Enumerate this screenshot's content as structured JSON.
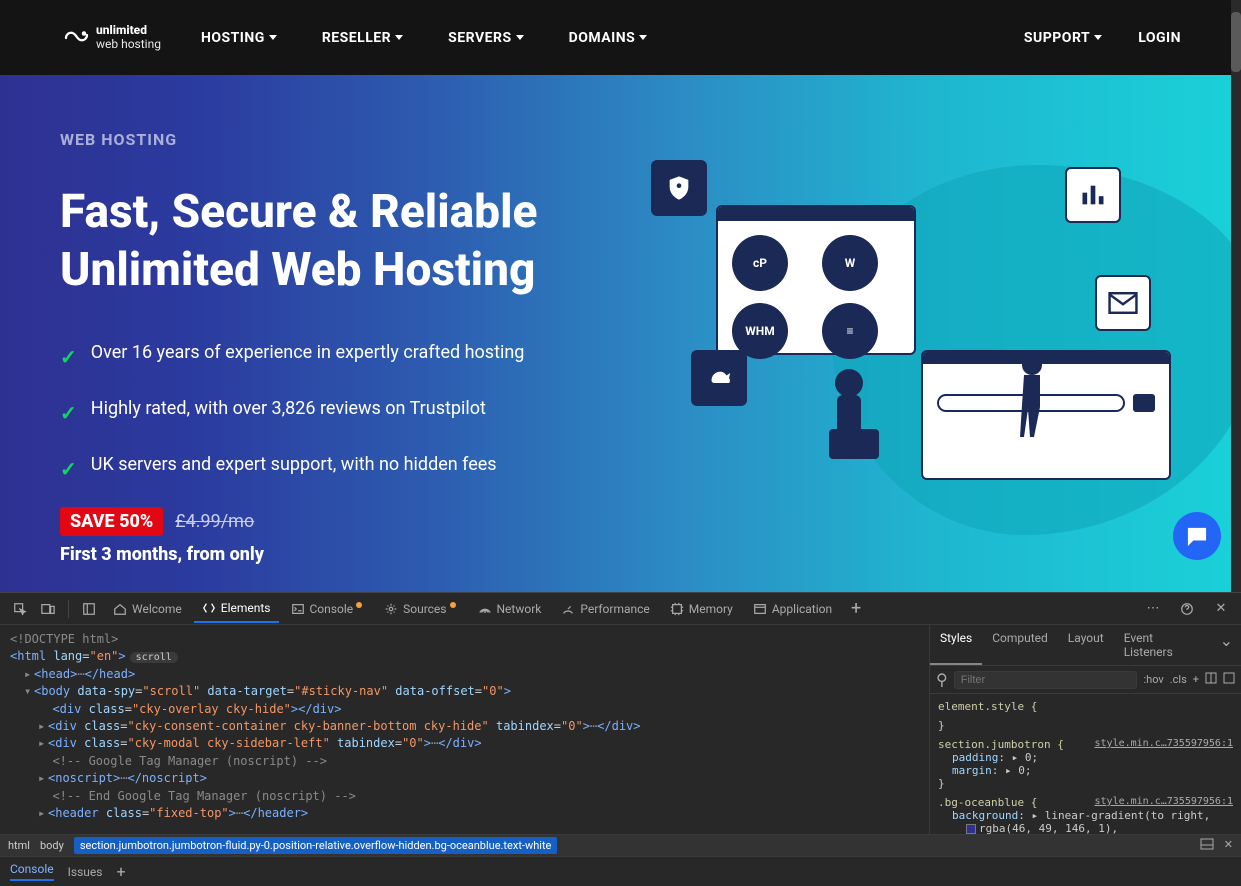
{
  "nav": {
    "logo_line1": "unlimited",
    "logo_line2": "web hosting",
    "items": [
      "HOSTING",
      "RESELLER",
      "SERVERS",
      "DOMAINS"
    ],
    "right": [
      "SUPPORT",
      "LOGIN"
    ]
  },
  "hero": {
    "eyebrow": "WEB HOSTING",
    "title": "Fast, Secure & Reliable Unlimited Web Hosting",
    "bullets": [
      "Over 16 years of experience in expertly crafted hosting",
      "Highly rated, with over 3,826 reviews on Trustpilot",
      "UK servers and expert support, with no hidden fees"
    ],
    "save_badge": "SAVE 50%",
    "strike_price": "£4.99/mo",
    "months_line": "First 3 months, from only"
  },
  "art": {
    "circle_labels": [
      "cP",
      "W",
      "WHM",
      "≡"
    ]
  },
  "devtools": {
    "tabs": [
      "Welcome",
      "Elements",
      "Console",
      "Sources",
      "Network",
      "Performance",
      "Memory",
      "Application"
    ],
    "active_tab": "Elements",
    "styles_tabs": [
      "Styles",
      "Computed",
      "Layout",
      "Event Listeners"
    ],
    "active_styles_tab": "Styles",
    "filter_placeholder": "Filter",
    "toolbar_pills": [
      ":hov",
      ".cls",
      "+"
    ],
    "dom": {
      "doctype": "<!DOCTYPE html>",
      "html_open": "<html lang=\"en\">",
      "scroll_pill": "scroll",
      "head": "<head>…</head>",
      "body_open": "<body data-spy=\"scroll\" data-target=\"#sticky-nav\" data-offset=\"0\">",
      "div1": "<div class=\"cky-overlay cky-hide\"></div>",
      "div2": "<div class=\"cky-consent-container cky-banner-bottom cky-hide\" tabindex=\"0\">…</div>",
      "div3": "<div class=\"cky-modal cky-sidebar-left\" tabindex=\"0\">…</div>",
      "c1": "<!-- Google Tag Manager (noscript) -->",
      "noscript": "<noscript>…</noscript>",
      "c2": "<!-- End Google Tag Manager (noscript) -->",
      "header": "<header class=\"fixed-top\">…</header>"
    },
    "crumbs": [
      "html",
      "body",
      "section.jumbotron.jumbotron-fluid.py-0.position-relative.overflow-hidden.bg-oceanblue.text-white"
    ],
    "styles": {
      "element_style": "element.style {",
      "rule1_sel": "section.jumbotron {",
      "rule1_src": "style.min.c…735597956:1",
      "rule1_p1n": "padding",
      "rule1_p1v": "▸ 0;",
      "rule1_p2n": "margin",
      "rule1_p2v": "▸ 0;",
      "rule2_sel": ".bg-oceanblue {",
      "rule2_src": "style.min.c…735597956:1",
      "rule2_p1n": "background",
      "rule2_p1v": "▸ linear-gradient(to right,",
      "rule2_p2": "rgba(46, 49, 146, 1),"
    },
    "console_drawer": {
      "tab1": "Console",
      "tab2": "Issues"
    }
  }
}
